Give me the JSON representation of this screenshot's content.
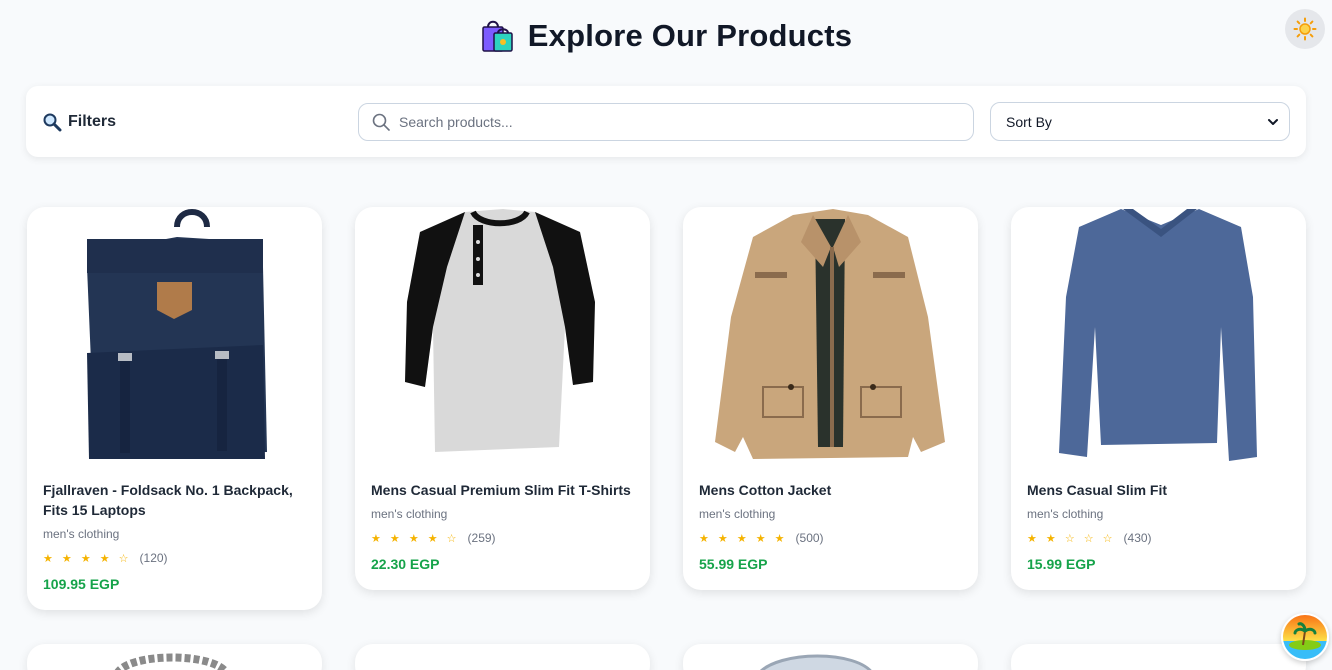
{
  "header": {
    "title": "Explore Our Products",
    "title_icon": "shopping-bags-icon",
    "theme_toggle_icon": "sun-icon"
  },
  "toolbar": {
    "filters_label": "Filters",
    "filters_icon": "magnifier-icon",
    "search": {
      "placeholder": "Search products...",
      "value": ""
    },
    "sort": {
      "selected": "Sort By"
    }
  },
  "products": [
    {
      "name": "Fjallraven - Foldsack No. 1 Backpack, Fits 15 Laptops",
      "category": "men's clothing",
      "stars": "★ ★ ★ ★ ☆",
      "rating": 3.9,
      "rating_count": "(120)",
      "price": "109.95 EGP",
      "image": "backpack"
    },
    {
      "name": "Mens Casual Premium Slim Fit T-Shirts",
      "category": "men's clothing",
      "stars": "★ ★ ★ ★ ☆",
      "rating": 4.1,
      "rating_count": "(259)",
      "price": "22.30 EGP",
      "image": "raglan-tshirt"
    },
    {
      "name": "Mens Cotton Jacket",
      "category": "men's clothing",
      "stars": "★ ★ ★ ★ ★",
      "rating": 4.7,
      "rating_count": "(500)",
      "price": "55.99 EGP",
      "image": "cotton-jacket"
    },
    {
      "name": "Mens Casual Slim Fit",
      "category": "men's clothing",
      "stars": "★ ★ ☆ ☆ ☆",
      "rating": 2.1,
      "rating_count": "(430)",
      "price": "15.99 EGP",
      "image": "long-sleeve-shirt"
    }
  ],
  "colors": {
    "accent_price": "#16a34a",
    "star": "#f5b301",
    "background": "#f8fafc"
  },
  "avatar_icon": "island-avatar-icon"
}
